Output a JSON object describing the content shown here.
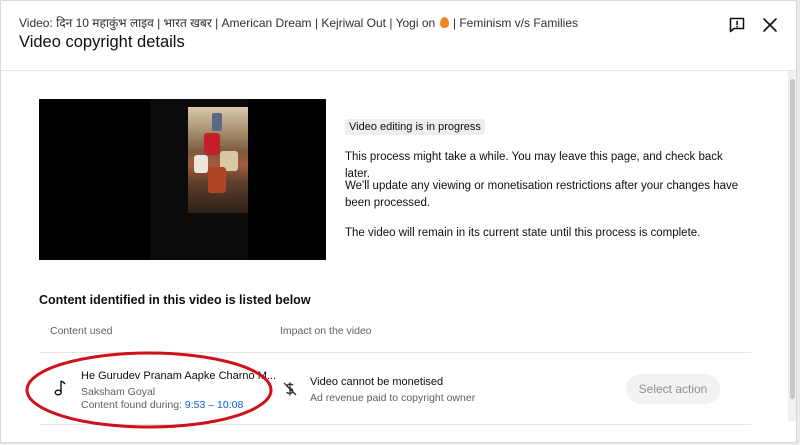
{
  "header": {
    "video_prefix": "Video: दिन 10 महाकुंभ लाइव | भारत खबर | American Dream | Kejriwal Out | Yogi on",
    "video_suffix": " | Feminism v/s Families",
    "title": "Video copyright details",
    "feedback_icon": "feedback-icon",
    "close_icon": "close-icon"
  },
  "status": {
    "badge": "Video editing is in progress",
    "line1": "This process might take a while. You may leave this page, and check back later.",
    "line2": "We'll update any viewing or monetisation restrictions after your changes have been processed.",
    "line3": "The video will remain in its current state until this process is complete."
  },
  "content": {
    "section_title": "Content identified in this video is listed below",
    "col_content": "Content used",
    "col_impact": "Impact on the video",
    "rows": [
      {
        "title": "He Gurudev Pranam Aapke Charno M...",
        "artist": "Saksham Goyal",
        "found_label": "Content found during:",
        "time_range": "9:53 – 10:08",
        "impact": "Video cannot be monetised",
        "impact_detail": "Ad revenue paid to copyright owner",
        "action": "Select action",
        "icon": "music-note-icon",
        "impact_icon": "monetisation-off-icon"
      }
    ]
  },
  "colors": {
    "link": "#065fd4",
    "annotation": "#d0101a",
    "badge_bg": "#eeeeee"
  }
}
